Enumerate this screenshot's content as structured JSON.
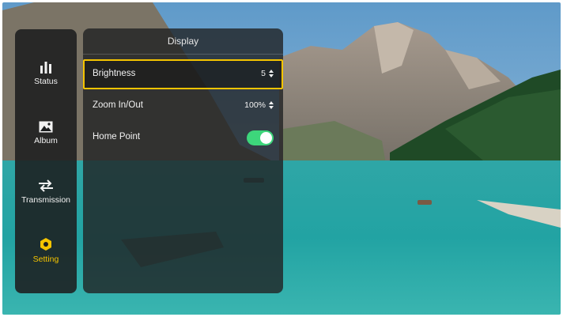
{
  "sidebar": {
    "items": [
      {
        "label": "Status",
        "icon": "bar-chart-icon"
      },
      {
        "label": "Album",
        "icon": "image-icon"
      },
      {
        "label": "Transmission",
        "icon": "transfer-arrows-icon"
      },
      {
        "label": "Setting",
        "icon": "hexagon-settings-icon",
        "active": true
      }
    ]
  },
  "panel": {
    "title": "Display",
    "rows": [
      {
        "label": "Brightness",
        "value": "5",
        "control": "stepper",
        "selected": true
      },
      {
        "label": "Zoom In/Out",
        "value": "100%",
        "control": "stepper"
      },
      {
        "label": "Home Point",
        "control": "toggle",
        "enabled": true
      }
    ]
  },
  "colors": {
    "accent": "#f5c400",
    "toggle_on": "#3dd67b",
    "panel_bg": "#202223",
    "text": "#f2f2f2"
  }
}
